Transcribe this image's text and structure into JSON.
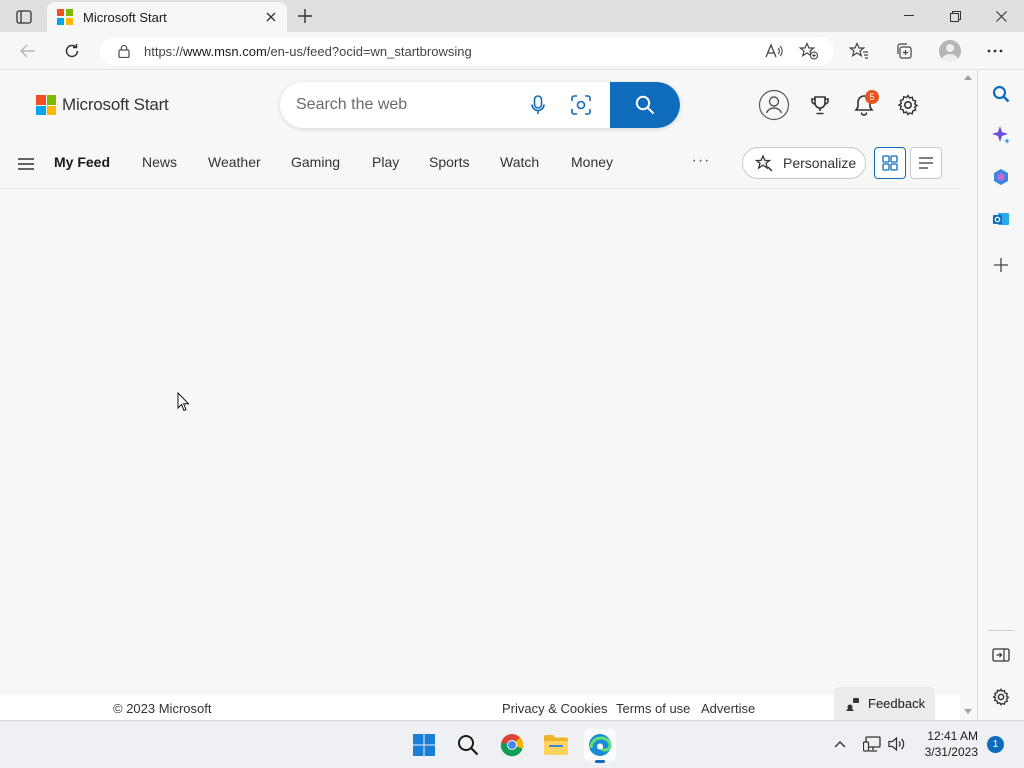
{
  "browser": {
    "tab": {
      "title": "Microsoft Start"
    },
    "address": {
      "url_prefix": "https://",
      "url_host": "www.msn.com",
      "url_path": "/en-us/feed?ocid=wn_startbrowsing"
    }
  },
  "header": {
    "brand": "Microsoft Start",
    "search": {
      "placeholder": "Search the web"
    },
    "notifications_count": "5"
  },
  "nav": {
    "items": [
      "My Feed",
      "News",
      "Weather",
      "Gaming",
      "Play",
      "Sports",
      "Watch",
      "Money"
    ],
    "more": "···",
    "personalize_label": "Personalize"
  },
  "footer": {
    "copyright": "© 2023 Microsoft",
    "links": [
      "Privacy & Cookies",
      "Terms of use",
      "Advertise"
    ],
    "feedback_label": "Feedback"
  },
  "taskbar": {
    "time": "12:41 AM",
    "date": "3/31/2023",
    "notification_count": "1"
  },
  "colors": {
    "accent": "#0f6cbd",
    "ms_red": "#f25022",
    "ms_green": "#7fba00",
    "ms_blue": "#00a4ef",
    "ms_yellow": "#ffb900",
    "badge": "#e8541e"
  }
}
